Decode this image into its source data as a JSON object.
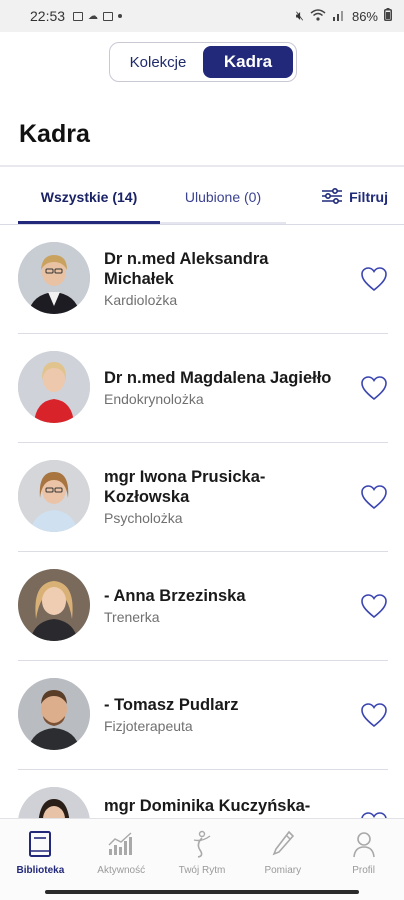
{
  "status_bar": {
    "time": "22:53",
    "battery": "86%"
  },
  "segmented": {
    "left_label": "Kolekcje",
    "right_label": "Kadra"
  },
  "page": {
    "title": "Kadra"
  },
  "tabs": {
    "all_label": "Wszystkie (14)",
    "fav_label": "Ulubione (0)",
    "filter_label": "Filtruj"
  },
  "staff": [
    {
      "name_line1": "Dr n.med Aleksandra",
      "name_line2": "Michałek",
      "role": "Kardiolożka"
    },
    {
      "name_line1": "Dr n.med Magdalena Jagiełło",
      "name_line2": "",
      "role": "Endokrynolożka"
    },
    {
      "name_line1": "mgr Iwona Prusicka-",
      "name_line2": "Kozłowska",
      "role": "Psycholożka"
    },
    {
      "name_line1": "- Anna Brzezinska",
      "name_line2": "",
      "role": "Trenerka"
    },
    {
      "name_line1": "- Tomasz Pudlarz",
      "name_line2": "",
      "role": "Fizjoterapeuta"
    },
    {
      "name_line1": "mgr Dominika Kuczyńska-",
      "name_line2": "",
      "role": ""
    }
  ],
  "bottom_nav": {
    "biblioteka": "Biblioteka",
    "aktywnosc": "Aktywność",
    "rytm": "Twój Rytm",
    "pomiary": "Pomiary",
    "profil": "Profil"
  },
  "colors": {
    "accent": "#22287a",
    "heart": "#3a45b0"
  }
}
